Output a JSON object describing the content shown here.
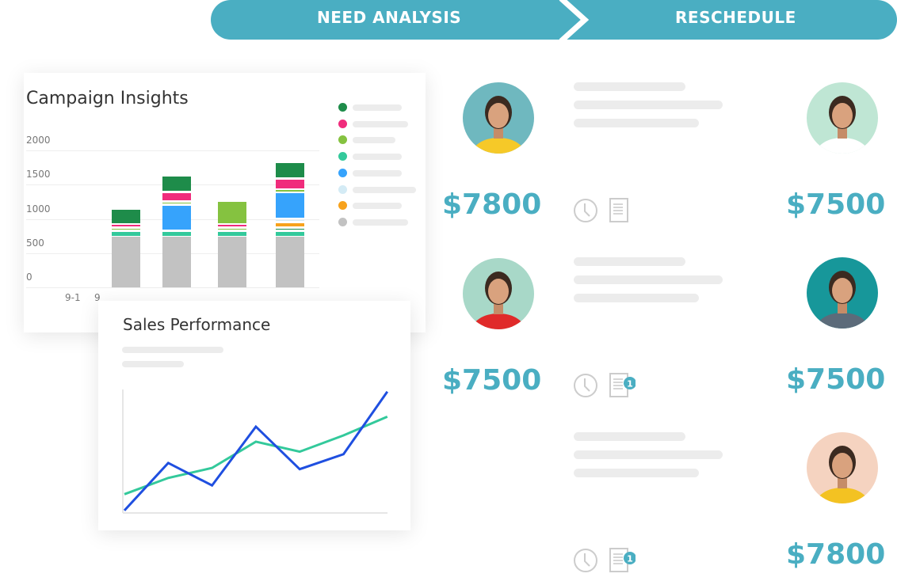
{
  "pipeline": {
    "stages": [
      {
        "label": "NEED ANALYSIS"
      },
      {
        "label": "RESCHEDULE"
      }
    ],
    "color": "#4aaec2"
  },
  "campaign": {
    "title": "Campaign Insights",
    "x_ticks_visible": [
      "9-1",
      "9"
    ]
  },
  "sales": {
    "title": "Sales Performance"
  },
  "chart_data": [
    {
      "type": "bar",
      "stacked": true,
      "title": "Campaign Insights",
      "ylim": [
        0,
        2000
      ],
      "y_ticks": [
        "0",
        "500",
        "1000",
        "1500",
        "2000"
      ],
      "grid": true,
      "legend": "right",
      "series_colors": [
        "#c2c2c2",
        "#33c99b",
        "#1e8c4a",
        "#85c240",
        "#f7a21c",
        "#d4ebf5",
        "#36a3fc",
        "#f02c7c",
        "#85c240",
        "#1e8c4a"
      ],
      "legend_colors": [
        "#1e8c4a",
        "#f02c7c",
        "#85c240",
        "#33c99b",
        "#36a3fc",
        "#d4ebf5",
        "#f7a21c",
        "#c2c2c2"
      ],
      "bars": [
        {
          "segments": [
            740,
            90,
            45,
            50,
            230
          ],
          "colors": [
            "#c2c2c2",
            "#33c99b",
            "#85c240",
            "#f02c7c",
            "#1e8c4a"
          ]
        },
        {
          "segments": [
            740,
            90,
            380,
            45,
            140,
            240
          ],
          "colors": [
            "#c2c2c2",
            "#33c99b",
            "#36a3fc",
            "#85c240",
            "#f02c7c",
            "#1e8c4a"
          ]
        },
        {
          "segments": [
            740,
            90,
            45,
            50,
            340
          ],
          "colors": [
            "#c2c2c2",
            "#33c99b",
            "#85c240",
            "#f02c7c",
            "#85c240"
          ]
        },
        {
          "segments": [
            740,
            90,
            45,
            80,
            45,
            390,
            45,
            160,
            240
          ],
          "colors": [
            "#c2c2c2",
            "#33c99b",
            "#1e8c4a",
            "#f7a21c",
            "#d4ebf5",
            "#36a3fc",
            "#85c240",
            "#f02c7c",
            "#1e8c4a"
          ]
        }
      ]
    },
    {
      "type": "line",
      "title": "Sales Performance",
      "ylim": [
        0,
        100
      ],
      "series": [
        {
          "color": "#1f4fe0",
          "values": [
            2,
            40,
            22,
            69,
            35,
            47,
            97
          ]
        },
        {
          "color": "#33c99b",
          "values": [
            15,
            28,
            36,
            57,
            49,
            62,
            77
          ]
        }
      ]
    }
  ],
  "deals_left": [
    {
      "amount": "$7800",
      "avatar_bg": "#6fb8bf",
      "shirt": "#f6c928"
    },
    {
      "amount": "$7500",
      "avatar_bg": "#a8d8c8",
      "shirt": "#e02a2a"
    }
  ],
  "deals_right": [
    {
      "amount": "$7500",
      "badge": "",
      "avatar_bg": "#bfe6d4",
      "shirt": "#ffffff"
    },
    {
      "amount": "$7500",
      "badge": "1",
      "avatar_bg": "#17979a",
      "shirt": "#5c6b7a"
    },
    {
      "amount": "$7800",
      "badge": "1",
      "avatar_bg": "#f5d3c0",
      "shirt": "#f3c222"
    }
  ]
}
